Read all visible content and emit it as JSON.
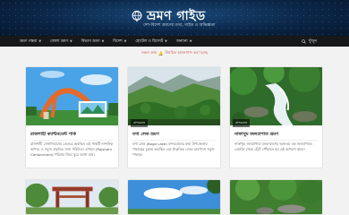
{
  "site": {
    "title": "ভ্রমণ গাইড",
    "tagline": "দেশ-বিদেশ ভ্রমণের তথ্য, গাইড ও অভিজ্ঞতা"
  },
  "nav": {
    "items": [
      {
        "label": "ভ্রমণ গন্তব্য",
        "icon": "chevron-down-icon"
      },
      {
        "label": "জেলা ভ্রমণ",
        "icon": "chevron-down-icon"
      },
      {
        "label": "বিভাগ ভ্রমণ",
        "icon": "chevron-down-icon"
      },
      {
        "label": "বিদেশ",
        "icon": "chevron-down-icon"
      },
      {
        "label": "হোটেল ও রিসোর্ট",
        "icon": "chevron-down-icon"
      },
      {
        "label": "অন্যান্য",
        "icon": "chevron-down-icon"
      }
    ],
    "search_label": "খুঁজুন"
  },
  "notice": {
    "text_before": "সকল তথ্য",
    "text_after": "নিয়মিত হালনাগাদ করা হচ্ছে"
  },
  "cards": [
    {
      "title": "রাজশাহী ক্যান্টনমেন্ট পার্ক",
      "tag": "",
      "excerpt": "রাজশাহী সেনানিবাসের ভেতরে অবস্থিত এই পার্কটি নান্দনিক স্থাপত্য ও সবুজ প্রকৃতির জন্য পরিচিত। এখানে (Rajshahi Cantonment) পরিবার নিয়ে ঘুরে আসা যায়।"
    },
    {
      "title": "বগা লেক ভ্রমণ",
      "tag": "বান্দরবান",
      "excerpt": "বগা লেক (Boga Lake) বান্দরবানের রুমা উপজেলায় পাহাড়ের চূড়ায় অবস্থিত এক প্রাকৃতিক লেক। চারপাশে সবুজ পাহাড়।"
    },
    {
      "title": "নাফাখুম জলপ্রপাত ভ্রমণ",
      "tag": "বান্দরবান",
      "excerpt": "নাফাখুম জলপ্রপাত বাংলাদেশের অন্যতম বড় জলপ্রপাত। রেমাক্রি থেকে হেঁটে পৌঁছাতে হয় এই অপরূপ স্থানে।"
    }
  ],
  "colors": {
    "header_bg": "#0b2647",
    "nav_bg": "#17181a",
    "notice_text": "#c0392b"
  }
}
